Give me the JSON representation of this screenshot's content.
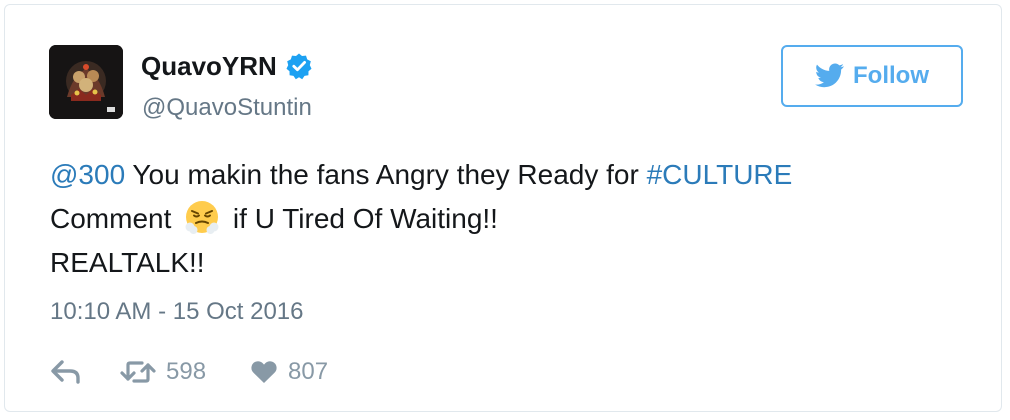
{
  "user": {
    "display_name": "QuavoYRN",
    "handle": "@QuavoStuntin",
    "verified": true,
    "avatar_icon": "album-cover-avatar"
  },
  "follow_button": {
    "label": "Follow",
    "icon": "twitter-bird-icon"
  },
  "tweet": {
    "mention": "@300",
    "line1_text": " You makin the fans Angry they Ready for ",
    "hashtag": "#CULTURE",
    "line2_before": "Comment ",
    "line2_emoji": "angry-steam-face-emoji",
    "line2_after": " if U Tired Of Waiting!!",
    "line3": "REALTALK!!"
  },
  "timestamp": "10:10 AM - 15 Oct 2016",
  "actions": {
    "reply_icon": "reply-icon",
    "retweet_icon": "retweet-icon",
    "retweet_count": "598",
    "like_icon": "heart-icon",
    "like_count": "807"
  },
  "colors": {
    "link": "#2b7bb9",
    "follow": "#55acee",
    "muted": "#657786",
    "action": "#8899a6",
    "verified": "#1da1f2"
  }
}
